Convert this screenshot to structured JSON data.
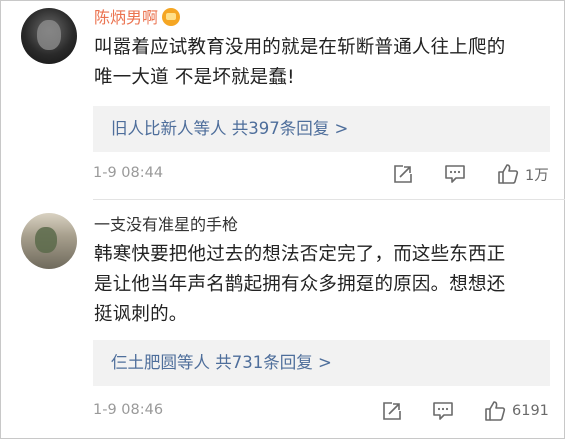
{
  "comments": [
    {
      "username": "陈炳男啊",
      "body_lines": [
        "叫嚣着应试教育没用的就是在斩断普通人往上爬的",
        "唯一大道 不是坏就是蠢!"
      ],
      "reply_summary": "旧人比新人等人  共397条回复 >",
      "timestamp": "1-9 08:44",
      "like_count": "1万"
    },
    {
      "username": "一支没有准星的手枪",
      "body_lines": [
        "韩寒快要把他过去的想法否定完了，而这些东西正",
        "是让他当年声名鹊起拥有众多拥趸的原因。想想还",
        "挺讽刺的。"
      ],
      "reply_summary": "仨土肥圆等人  共731条回复 >",
      "timestamp": "1-9 08:46",
      "like_count": "6191"
    }
  ],
  "colors": {
    "username_vip": "#eb7350",
    "link_blue": "#4e6e9b",
    "meta_gray": "#9a9a9a",
    "reply_bg": "#f2f2f2"
  },
  "icons": {
    "repost": "share-box-icon",
    "comment": "comment-bubble-icon",
    "like": "thumbs-up-icon",
    "vip": "vip-crown-badge-icon"
  }
}
